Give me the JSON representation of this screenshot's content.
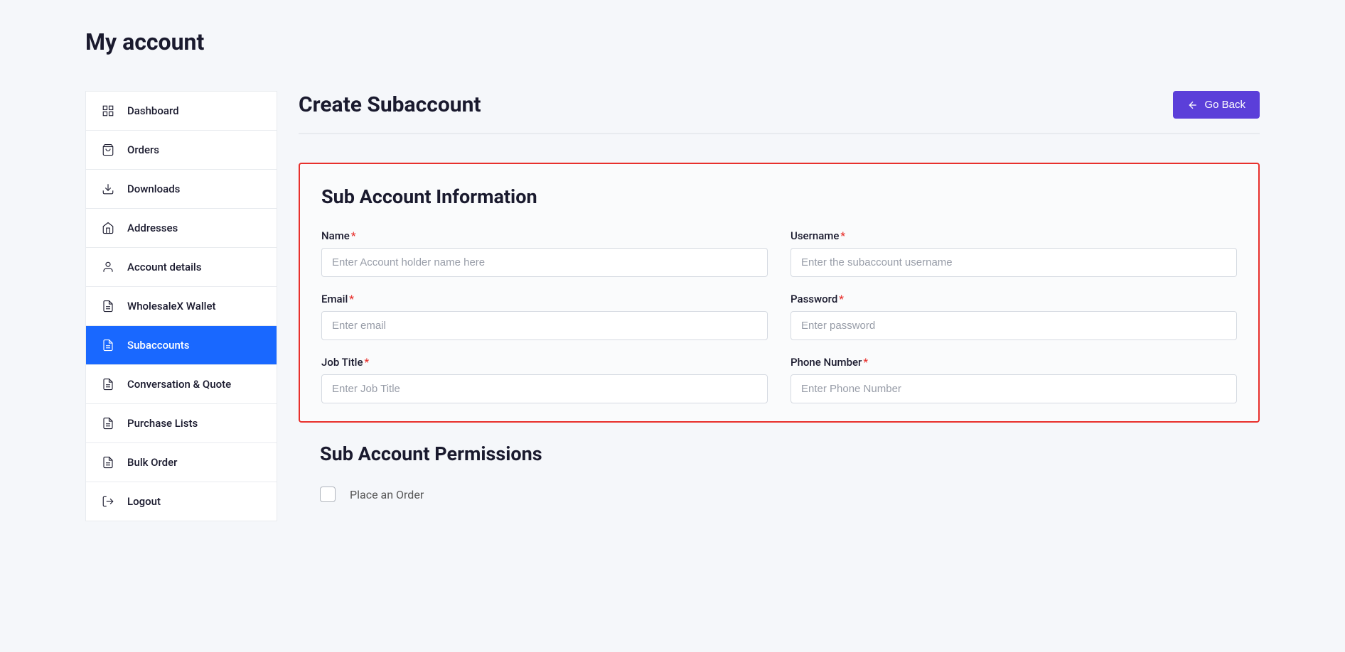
{
  "pageTitle": "My account",
  "sidebar": {
    "items": [
      {
        "label": "Dashboard"
      },
      {
        "label": "Orders"
      },
      {
        "label": "Downloads"
      },
      {
        "label": "Addresses"
      },
      {
        "label": "Account details"
      },
      {
        "label": "WholesaleX Wallet"
      },
      {
        "label": "Subaccounts"
      },
      {
        "label": "Conversation & Quote"
      },
      {
        "label": "Purchase Lists"
      },
      {
        "label": "Bulk Order"
      },
      {
        "label": "Logout"
      }
    ]
  },
  "content": {
    "title": "Create Subaccount",
    "goBackButton": "Go Back",
    "infoSection": {
      "title": "Sub Account Information",
      "fields": {
        "name": {
          "label": "Name",
          "placeholder": "Enter Account holder name here"
        },
        "username": {
          "label": "Username",
          "placeholder": "Enter the subaccount username"
        },
        "email": {
          "label": "Email",
          "placeholder": "Enter email"
        },
        "password": {
          "label": "Password",
          "placeholder": "Enter password"
        },
        "jobTitle": {
          "label": "Job Title",
          "placeholder": "Enter Job Title"
        },
        "phoneNumber": {
          "label": "Phone Number",
          "placeholder": "Enter Phone Number"
        }
      }
    },
    "permissionsSection": {
      "title": "Sub Account Permissions",
      "items": [
        {
          "label": "Place an Order"
        }
      ]
    }
  }
}
